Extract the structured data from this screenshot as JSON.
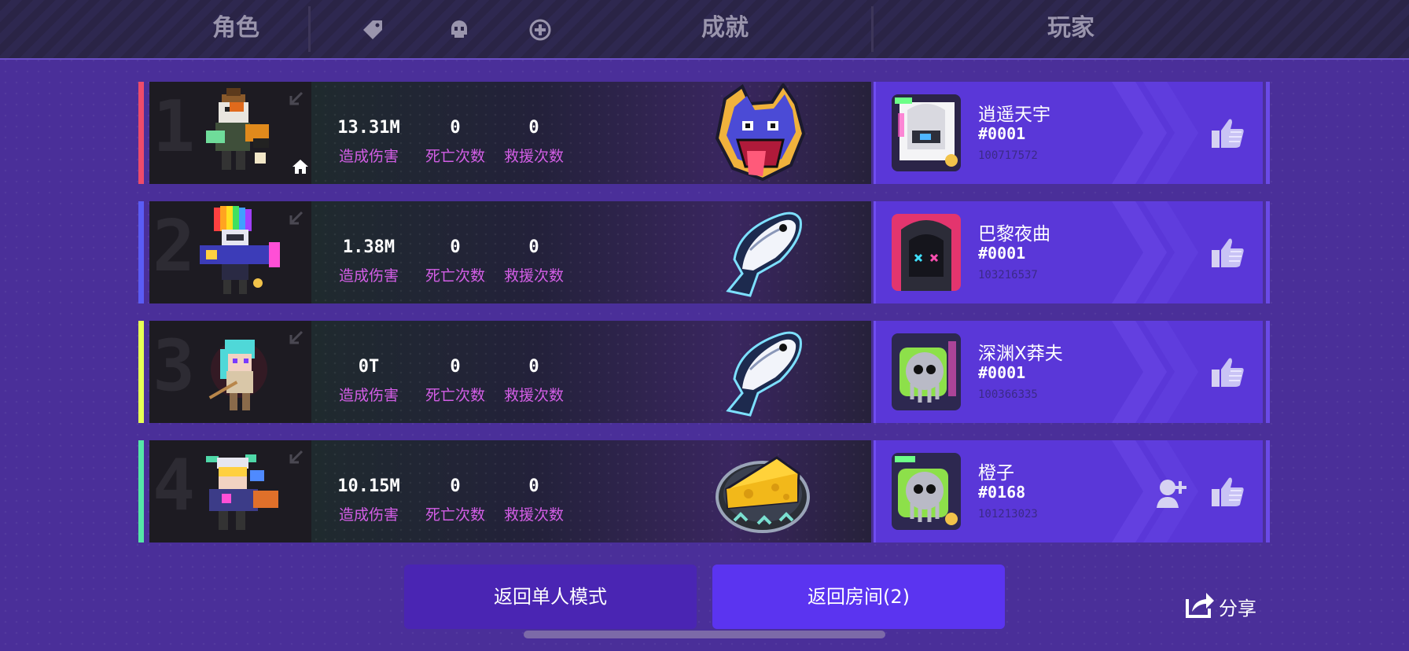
{
  "header": {
    "role_label": "角色",
    "achievement_label": "成就",
    "player_label": "玩家",
    "icons": [
      "tag-icon",
      "skull-icon",
      "revive-icon"
    ]
  },
  "stat_labels": {
    "damage": "造成伤害",
    "deaths": "死亡次数",
    "rescues": "救援次数"
  },
  "rows": [
    {
      "rank": "1",
      "accent": "#ee4b6a",
      "damage": "13.31M",
      "deaths": "0",
      "rescues": "0",
      "achievement": "wolf-badge",
      "player": {
        "name": "逍遥天宇",
        "tag": "#0001",
        "id": "100717572"
      },
      "is_host": true,
      "can_add_friend": false
    },
    {
      "rank": "2",
      "accent": "#5a5cf5",
      "damage": "1.38M",
      "deaths": "0",
      "rescues": "0",
      "achievement": "fish-badge",
      "player": {
        "name": "巴黎夜曲",
        "tag": "#0001",
        "id": "103216537"
      },
      "is_host": false,
      "can_add_friend": false
    },
    {
      "rank": "3",
      "accent": "#e7ff55",
      "damage": "0T",
      "deaths": "0",
      "rescues": "0",
      "achievement": "fish-badge",
      "player": {
        "name": "深渊X莽夫",
        "tag": "#0001",
        "id": "100366335"
      },
      "is_host": false,
      "can_add_friend": false
    },
    {
      "rank": "4",
      "accent": "#55e6a8",
      "damage": "10.15M",
      "deaths": "0",
      "rescues": "0",
      "achievement": "cheese-badge",
      "player": {
        "name": "橙子",
        "tag": "#0168",
        "id": "101213023"
      },
      "is_host": false,
      "can_add_friend": true
    }
  ],
  "buttons": {
    "single_mode": "返回单人模式",
    "room": "返回房间(2)",
    "share": "分享"
  }
}
